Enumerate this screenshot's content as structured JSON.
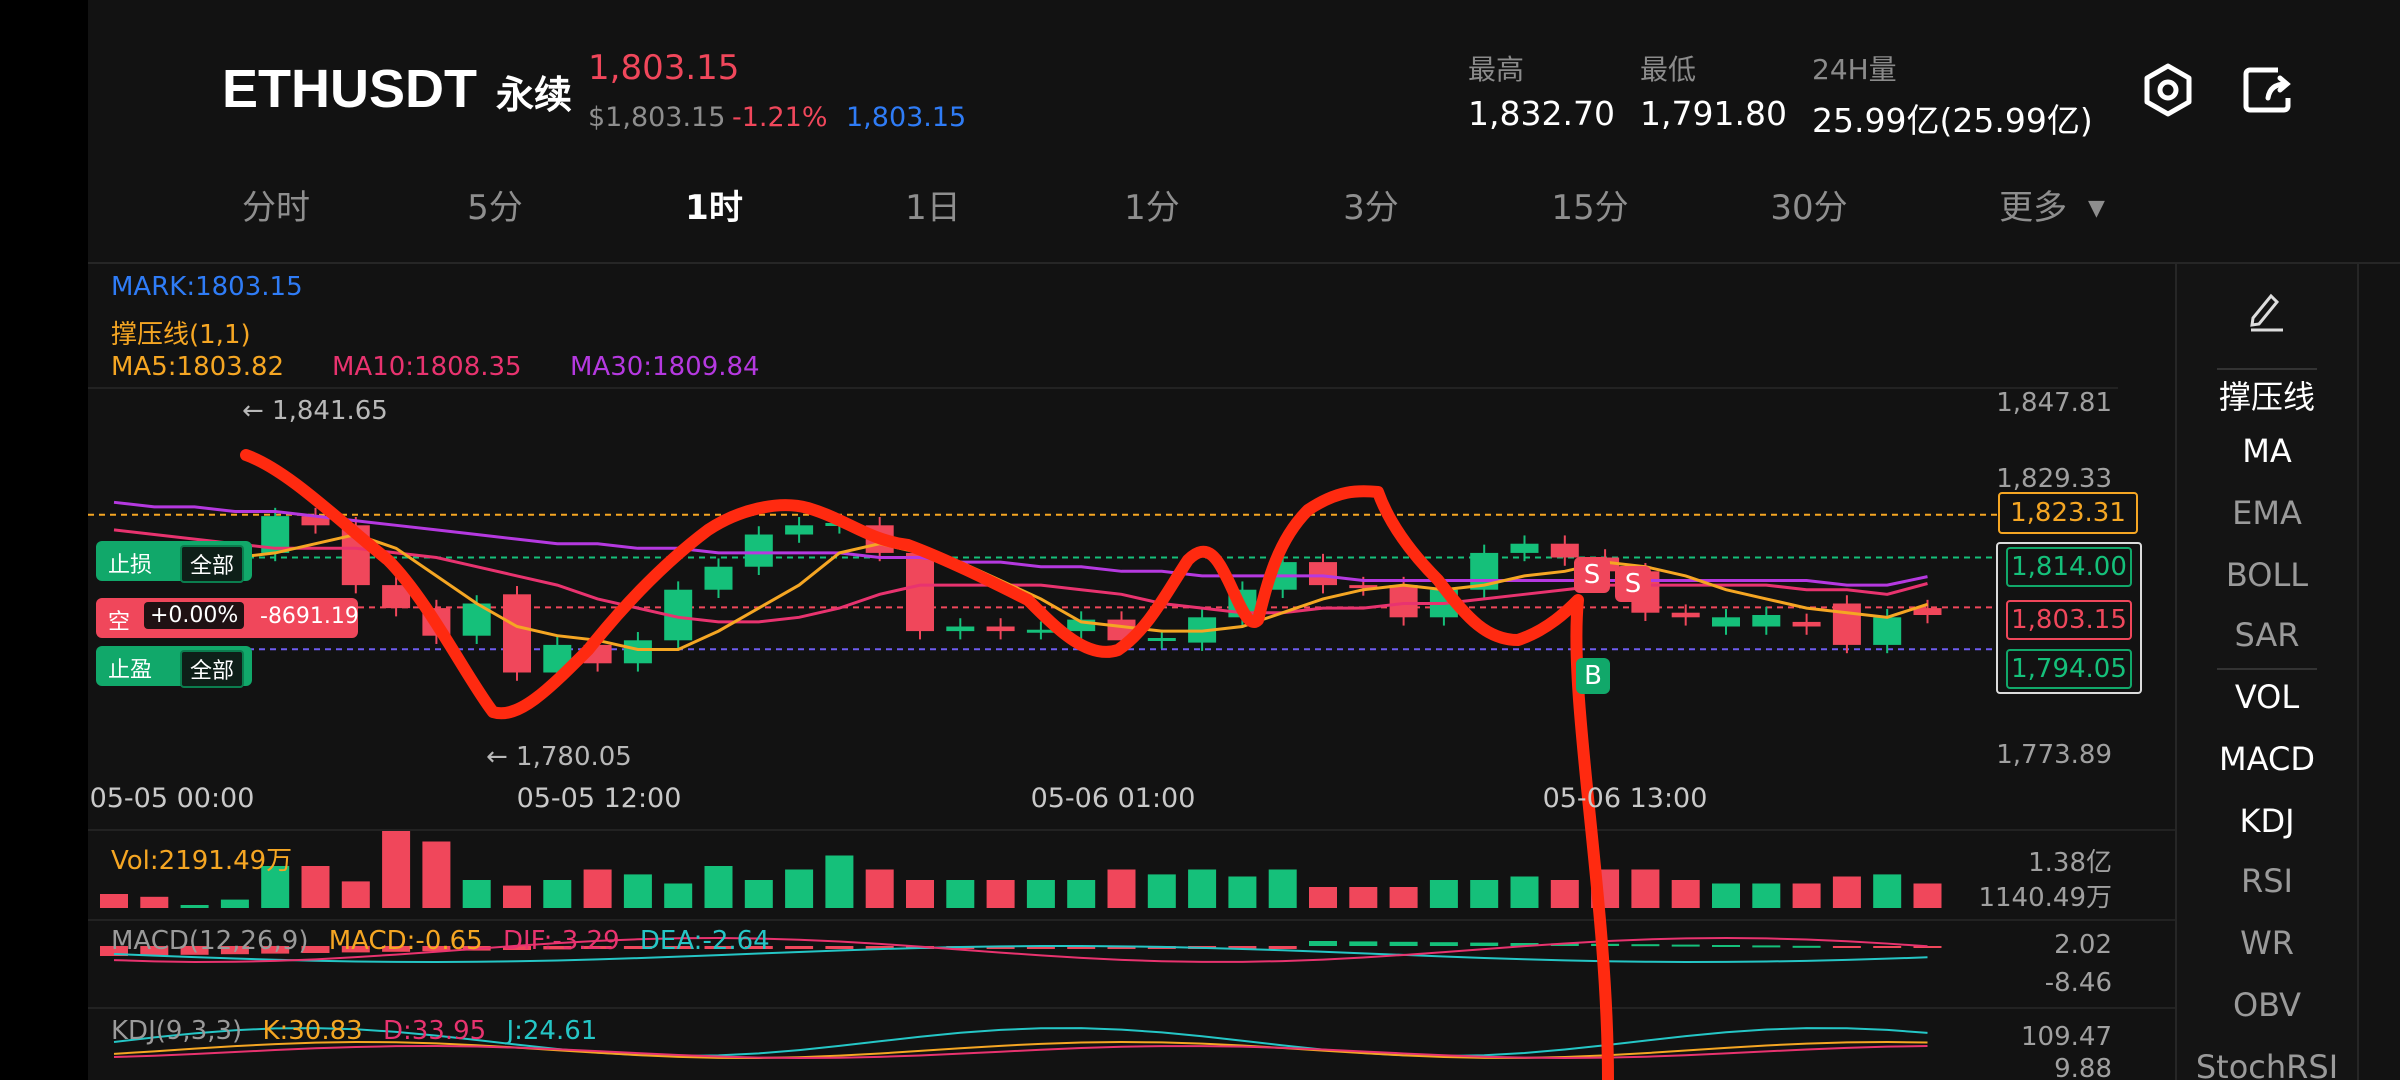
{
  "header": {
    "symbol": "ETHUSDT",
    "contract_type": "永续",
    "last_price": "1,803.15",
    "usd_price": "$1,803.15",
    "change_pct": "-1.21%",
    "mark_price": "1,803.15",
    "high_label": "最高",
    "high_value": "1,832.70",
    "low_label": "最低",
    "low_value": "1,791.80",
    "vol_label": "24H量",
    "vol_value": "25.99亿(25.99亿)",
    "settings_icon": "settings-hexagon-icon",
    "share_icon": "share-icon"
  },
  "tabs": [
    {
      "label": "分时",
      "active": false
    },
    {
      "label": "5分",
      "active": false
    },
    {
      "label": "1时",
      "active": true
    },
    {
      "label": "1日",
      "active": false
    },
    {
      "label": "1分",
      "active": false
    },
    {
      "label": "3分",
      "active": false
    },
    {
      "label": "15分",
      "active": false
    },
    {
      "label": "30分",
      "active": false
    },
    {
      "label": "更多",
      "active": false
    }
  ],
  "legend": {
    "mark": "MARK:1803.15",
    "support": "撑压线(1,1)",
    "ma5": "MA5:1803.82",
    "ma10": "MA10:1808.35",
    "ma30": "MA30:1809.84"
  },
  "price_axis": {
    "top": "1,847.81",
    "second": "1,829.33",
    "bottom": "1,773.89"
  },
  "annotations": {
    "high": "← 1,841.65",
    "low": "← 1,780.05"
  },
  "position": {
    "stop_loss_label": "止损",
    "stop_loss_value": "全部",
    "side": "空",
    "leverage": "+0.00%",
    "pnl": "-8691.19",
    "take_profit_label": "止盈",
    "take_profit_value": "全部"
  },
  "right_tags": {
    "resistance": "1,823.31",
    "stop_loss": "1,814.00",
    "current": "1,803.15",
    "take_profit": "1,794.05"
  },
  "trade_marks": {
    "sell": "S",
    "buy": "B"
  },
  "time_axis": [
    "05-05 00:00",
    "05-05 12:00",
    "05-06 01:00",
    "05-06 13:00"
  ],
  "volume": {
    "label": "Vol:2191.49万",
    "axis_top": "1.38亿",
    "axis_bottom": "1140.49万"
  },
  "macd": {
    "label": "MACD(12,26,9)",
    "macd": "MACD:-0.65",
    "dif": "DIF:-3.29",
    "dea": "DEA:-2.64",
    "axis_top": "2.02",
    "axis_bottom": "-8.46"
  },
  "kdj": {
    "label": "KDJ(9,3,3)",
    "k": "K:30.83",
    "d": "D:33.95",
    "j": "J:24.61",
    "axis_top": "109.47",
    "axis_bottom": "9.88"
  },
  "sidebar": {
    "edit_icon": "pencil-icon",
    "items": [
      {
        "label": "撑压线",
        "on": true
      },
      {
        "label": "MA",
        "on": true
      },
      {
        "label": "EMA",
        "on": false
      },
      {
        "label": "BOLL",
        "on": false
      },
      {
        "label": "SAR",
        "on": false
      },
      {
        "label": "VOL",
        "on": true
      },
      {
        "label": "MACD",
        "on": true
      },
      {
        "label": "KDJ",
        "on": true
      },
      {
        "label": "RSI",
        "on": false
      },
      {
        "label": "WR",
        "on": false
      },
      {
        "label": "OBV",
        "on": false
      },
      {
        "label": "StochRSI",
        "on": false
      }
    ]
  },
  "colors": {
    "up": "#15c07a",
    "down": "#f0475b",
    "ma5": "#f5a623",
    "ma10": "#e8336f",
    "ma30": "#b539e0",
    "mark": "#2f7cf6",
    "drawing": "#ff2a10"
  },
  "chart_data": {
    "type": "candlestick",
    "interval": "1h",
    "candles": [
      {
        "o": 1815,
        "c": 1814
      },
      {
        "o": 1814,
        "c": 1813
      },
      {
        "o": 1813,
        "c": 1813.5
      },
      {
        "o": 1813.5,
        "c": 1815
      },
      {
        "o": 1815,
        "c": 1823
      },
      {
        "o": 1823,
        "c": 1821
      },
      {
        "o": 1821,
        "c": 1808
      },
      {
        "o": 1808,
        "c": 1803
      },
      {
        "o": 1803,
        "c": 1797
      },
      {
        "o": 1797,
        "c": 1804
      },
      {
        "o": 1806,
        "c": 1789
      },
      {
        "o": 1789,
        "c": 1795
      },
      {
        "o": 1795,
        "c": 1791
      },
      {
        "o": 1791,
        "c": 1796
      },
      {
        "o": 1796,
        "c": 1807
      },
      {
        "o": 1807,
        "c": 1812
      },
      {
        "o": 1812,
        "c": 1819
      },
      {
        "o": 1819,
        "c": 1821
      },
      {
        "o": 1821,
        "c": 1821.5
      },
      {
        "o": 1821,
        "c": 1815
      },
      {
        "o": 1815,
        "c": 1798
      },
      {
        "o": 1798,
        "c": 1799
      },
      {
        "o": 1799,
        "c": 1798
      },
      {
        "o": 1798,
        "c": 1798.3
      },
      {
        "o": 1798,
        "c": 1800.5
      },
      {
        "o": 1800.5,
        "c": 1796
      },
      {
        "o": 1796,
        "c": 1796.5
      },
      {
        "o": 1795.5,
        "c": 1801
      },
      {
        "o": 1801,
        "c": 1807
      },
      {
        "o": 1807,
        "c": 1813
      },
      {
        "o": 1813,
        "c": 1808
      },
      {
        "o": 1808,
        "c": 1807.5
      },
      {
        "o": 1808,
        "c": 1801
      },
      {
        "o": 1801,
        "c": 1807
      },
      {
        "o": 1807,
        "c": 1815
      },
      {
        "o": 1815,
        "c": 1817
      },
      {
        "o": 1817,
        "c": 1814
      },
      {
        "o": 1814,
        "c": 1811
      },
      {
        "o": 1811,
        "c": 1802
      },
      {
        "o": 1802,
        "c": 1801
      },
      {
        "o": 1799,
        "c": 1801
      },
      {
        "o": 1799,
        "c": 1801.5
      },
      {
        "o": 1800,
        "c": 1799
      },
      {
        "o": 1804,
        "c": 1795
      },
      {
        "o": 1795,
        "c": 1801
      },
      {
        "o": 1803,
        "c": 1801.5
      }
    ],
    "ma5": [
      1817,
      1815,
      1814,
      1814,
      1815,
      1817,
      1819,
      1816,
      1810,
      1804,
      1799,
      1797,
      1796,
      1794,
      1794,
      1798,
      1803,
      1808,
      1815,
      1817,
      1815,
      1813,
      1809,
      1805,
      1800,
      1799,
      1798,
      1798,
      1799,
      1802,
      1805,
      1807,
      1808,
      1807,
      1808,
      1810,
      1811,
      1813,
      1812,
      1810,
      1807,
      1805,
      1803,
      1802,
      1801,
      1803.82
    ],
    "ma10": [
      1820,
      1819,
      1818,
      1817,
      1816,
      1816,
      1816,
      1815,
      1814,
      1812,
      1810,
      1808,
      1805,
      1803,
      1801,
      1800,
      1800,
      1801,
      1803,
      1806,
      1808,
      1808,
      1808,
      1808,
      1807,
      1806,
      1804,
      1803,
      1802,
      1802,
      1803,
      1803,
      1804,
      1804,
      1805,
      1806,
      1807,
      1808,
      1808,
      1808,
      1808,
      1808,
      1807,
      1807,
      1806,
      1808.35
    ],
    "ma30": [
      1826,
      1825,
      1825,
      1824,
      1824,
      1823,
      1822,
      1821,
      1820,
      1819,
      1818,
      1817,
      1817,
      1816,
      1816,
      1815,
      1815,
      1815,
      1815,
      1814,
      1814,
      1813,
      1813,
      1812,
      1812,
      1811,
      1811,
      1810,
      1810,
      1810,
      1810,
      1809,
      1809,
      1809,
      1809,
      1809,
      1809,
      1809,
      1809,
      1809,
      1809,
      1809,
      1809,
      1808,
      1808,
      1809.84
    ],
    "ylim": [
      1773.89,
      1847.81
    ],
    "volume": [
      20,
      16,
      0,
      12,
      60,
      60,
      38,
      110,
      95,
      40,
      32,
      40,
      55,
      48,
      35,
      60,
      40,
      55,
      75,
      55,
      40,
      40,
      40,
      40,
      40,
      55,
      48,
      55,
      45,
      55,
      30,
      30,
      30,
      40,
      40,
      45,
      40,
      55,
      55,
      40,
      35,
      35,
      35,
      45,
      48,
      35
    ]
  }
}
